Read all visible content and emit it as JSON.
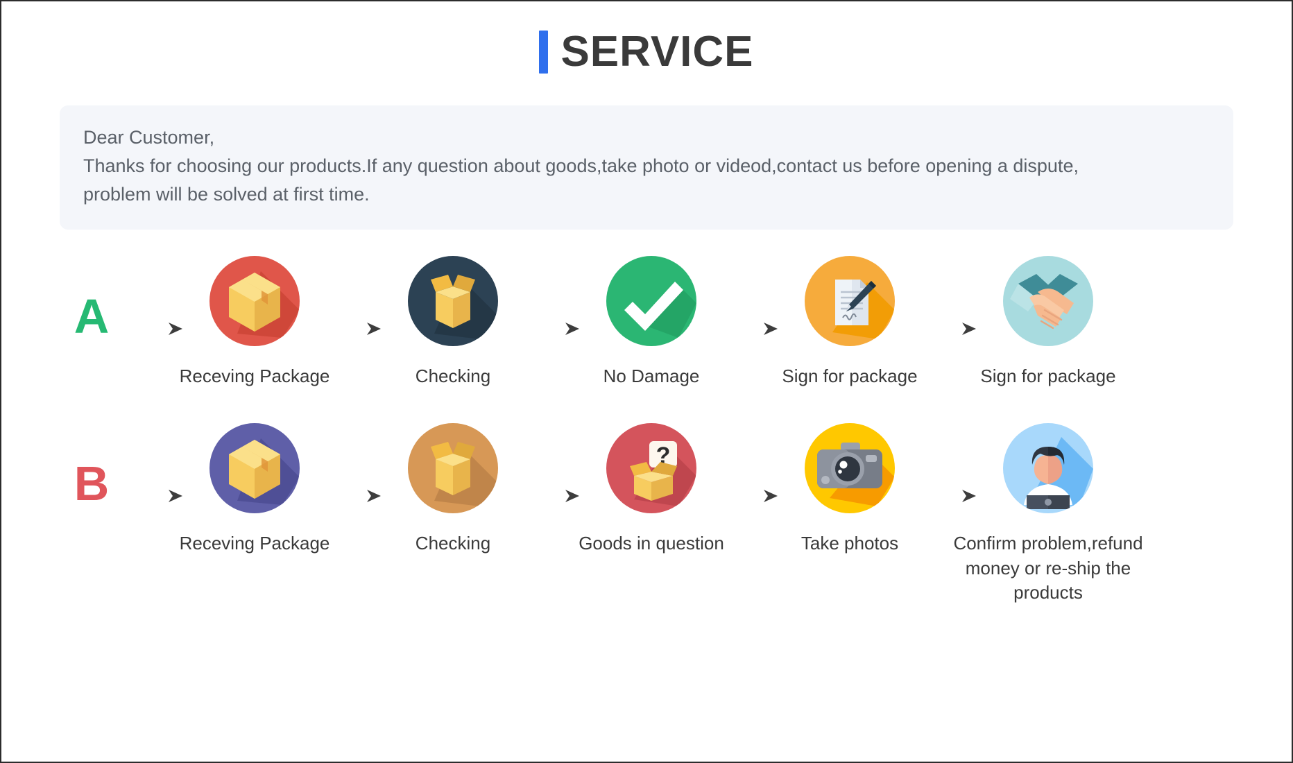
{
  "header": {
    "accent_color": "#2f6fed",
    "title": "SERVICE"
  },
  "notice": {
    "line1": "Dear Customer,",
    "line2": "Thanks for choosing our products.If any question about goods,take photo or videod,contact us before opening a dispute,",
    "line3": "problem will be solved at first time."
  },
  "flows": [
    {
      "letter": "A",
      "letter_color": "#26b973",
      "steps": [
        {
          "label": "Receving Package",
          "icon": "package-box-icon",
          "circle_color": "#e0564a"
        },
        {
          "label": "Checking",
          "icon": "open-box-icon",
          "circle_color": "#2c4254"
        },
        {
          "label": "No Damage",
          "icon": "checkmark-icon",
          "circle_color": "#2bb673"
        },
        {
          "label": "Sign for package",
          "icon": "document-pen-icon",
          "circle_color": "#f6ab3c"
        },
        {
          "label": "Sign for package",
          "icon": "handshake-icon",
          "circle_color": "#a8dbdf"
        }
      ]
    },
    {
      "letter": "B",
      "letter_color": "#e0555b",
      "steps": [
        {
          "label": "Receving Package",
          "icon": "package-box-icon",
          "circle_color": "#5f5fa8"
        },
        {
          "label": "Checking",
          "icon": "open-box-icon",
          "circle_color": "#d79856"
        },
        {
          "label": "Goods in question",
          "icon": "question-box-icon",
          "circle_color": "#d4545c"
        },
        {
          "label": "Take photos",
          "icon": "camera-icon",
          "circle_color": "#ffc800"
        },
        {
          "label": "Confirm problem,refund money or re-ship the products",
          "icon": "support-agent-icon",
          "circle_color": "#a8d8fb"
        }
      ]
    }
  ]
}
